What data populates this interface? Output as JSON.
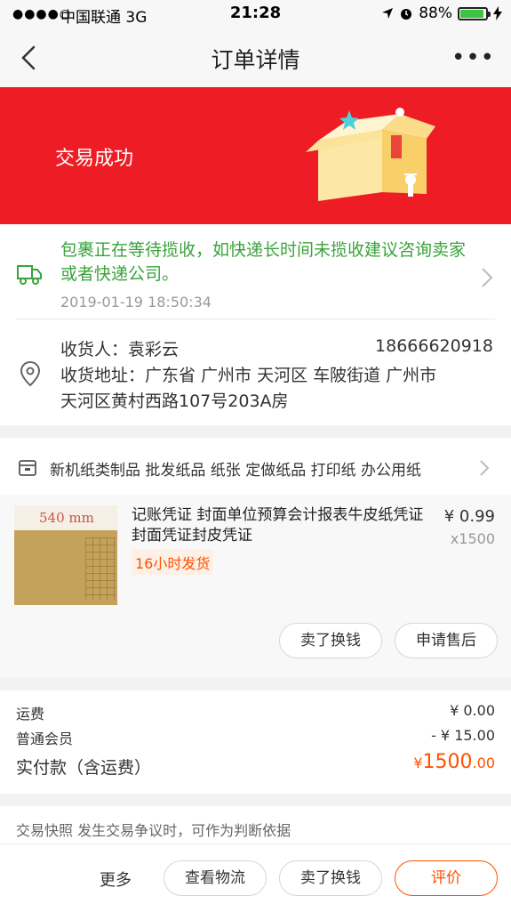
{
  "status_bar": {
    "signal": "●●●●○",
    "carrier": "中国联通  3G",
    "time": "21:28",
    "battery": "88%",
    "battery_level": 0.88,
    "accent": "#3cc540"
  },
  "nav": {
    "title": "订单详情",
    "more": "•••",
    "back_icon": "chevron-left-icon"
  },
  "banner": {
    "status_text": "交易成功",
    "color": "#ee1c25"
  },
  "logistics": {
    "message": "包裹正在等待揽收，如快递长时间未揽收建议咨询卖家或者快递公司。",
    "time": "2019-01-19 18:50:34",
    "color": "#3aa33b"
  },
  "address": {
    "receiver": "收货人：袁彩云",
    "phone": "18666620918",
    "address_line1": "收货地址：广东省 广州市 天河区   车陂街道 广州市",
    "address_line2": "天河区黄村西路107号203A房"
  },
  "shop": {
    "name": "新机纸类制品 批发纸品 纸张 定做纸品 打印纸 办公用纸"
  },
  "product": {
    "image_text": "540 mm",
    "title": "记账凭证 封面单位预算会计报表牛皮纸凭证封面凭证封皮凭证",
    "price": "¥ 0.99",
    "quantity": "x1500",
    "ship_tag": "16小时发货",
    "sell_label": "卖了换钱",
    "after_sale_label": "申请售后"
  },
  "costs": {
    "shipping_label": "运费",
    "shipping_value": "¥ 0.00",
    "member_label": "普通会员",
    "member_value": "- ¥ 15.00",
    "paid_label": "实付款（含运费）",
    "paid_currency": "¥",
    "paid_int": "1500",
    "paid_dec": ".00",
    "accent": "#ff5000"
  },
  "snapshot": {
    "text": "交易快照   发生交易争议时，可作为判断依据"
  },
  "bottom_bar": {
    "more": "更多",
    "logistics": "查看物流",
    "sell": "卖了换钱",
    "rate": "评价"
  }
}
